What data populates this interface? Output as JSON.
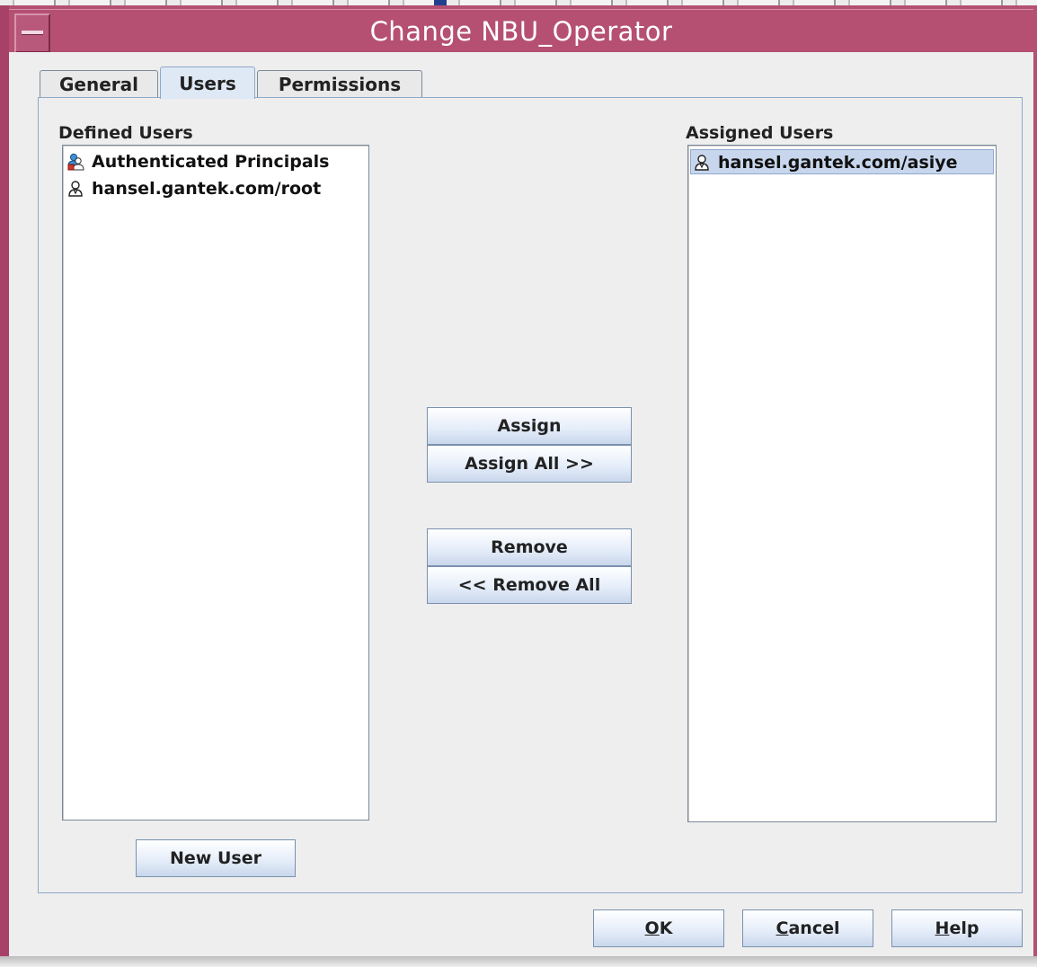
{
  "window": {
    "title": "Change NBU_Operator"
  },
  "tabs": [
    {
      "label": "General"
    },
    {
      "label": "Users"
    },
    {
      "label": "Permissions"
    }
  ],
  "active_tab": "Users",
  "defined_users": {
    "label": "Defined Users",
    "items": [
      {
        "label": "Authenticated Principals",
        "icon": "group-users-icon"
      },
      {
        "label": "hansel.gantek.com/root",
        "icon": "user-icon"
      }
    ]
  },
  "assigned_users": {
    "label": "Assigned Users",
    "items": [
      {
        "label": "hansel.gantek.com/asiye",
        "icon": "user-icon",
        "selected": true
      }
    ]
  },
  "actions": {
    "assign": "Assign",
    "assign_all": "Assign All >>",
    "remove": "Remove",
    "remove_all": "<< Remove All",
    "new_user": "New User"
  },
  "footer": {
    "ok": {
      "mnemonic": "O",
      "rest": "K"
    },
    "cancel": {
      "mnemonic": "C",
      "rest": "ancel"
    },
    "help": {
      "mnemonic": "H",
      "rest": "elp"
    }
  },
  "colors": {
    "titlebar": "#b55073",
    "client_bg": "#eeeeee",
    "selection": "#c7d6ec",
    "button_top": "#ffffff",
    "button_bottom": "#c9d7ec"
  }
}
